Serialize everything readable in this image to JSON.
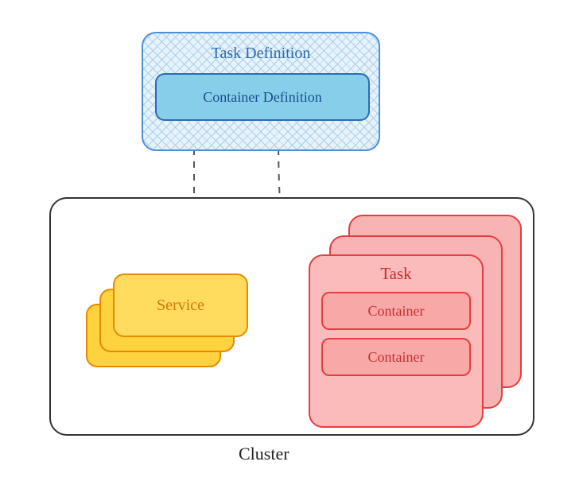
{
  "diagram": {
    "taskDefinition": {
      "title": "Task Definition",
      "containerDefinition": "Container Definition"
    },
    "cluster": {
      "label": "Cluster",
      "service": {
        "label": "Service"
      },
      "task": {
        "title": "Task",
        "containers": [
          "Container",
          "Container"
        ]
      }
    }
  }
}
